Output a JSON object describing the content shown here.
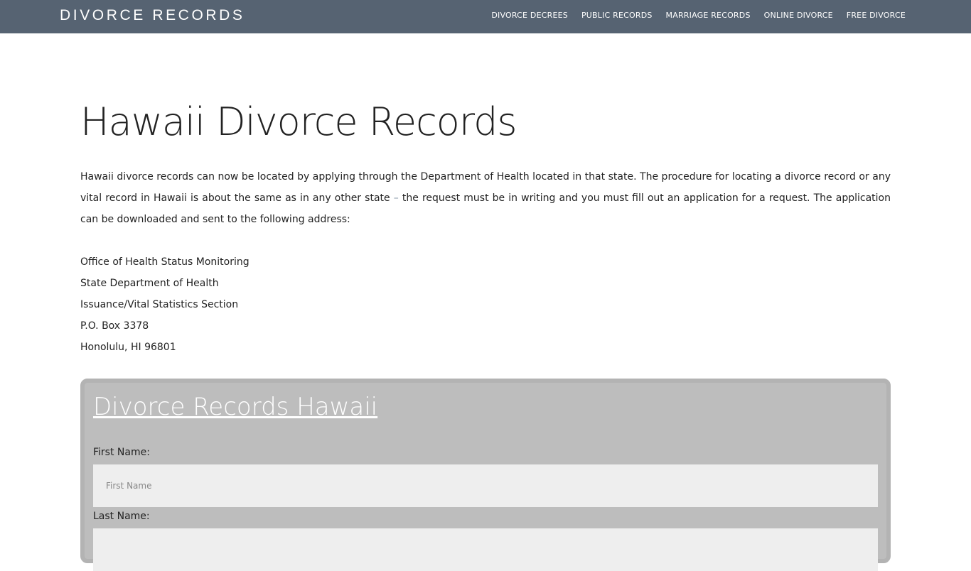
{
  "header": {
    "brand": "DIVORCE RECORDS",
    "nav": [
      {
        "label": "DIVORCE DECREES"
      },
      {
        "label": "PUBLIC RECORDS"
      },
      {
        "label": "MARRIAGE RECORDS"
      },
      {
        "label": "ONLINE DIVORCE"
      },
      {
        "label": "FREE DIVORCE"
      }
    ]
  },
  "main": {
    "title": "Hawaii Divorce Records",
    "intro_part1": "Hawaii divorce records can now be located by applying through the Department of Health located in that state. The procedure for locating a divorce record or any vital record in Hawaii is about the same as in any other state ",
    "intro_dash": "–",
    "intro_part2": " the request must be in writing and you must fill out an application for a request. The application can be downloaded and sent to the following address:",
    "address": [
      "Office of Health Status Monitoring",
      "State Department of Health",
      "Issuance/Vital Statistics Section",
      "P.O. Box 3378",
      "Honolulu, HI 96801"
    ]
  },
  "form": {
    "title": "Divorce Records Hawaii",
    "first_name_label": "First Name:",
    "first_name_placeholder": "First Name",
    "last_name_label": "Last Name:",
    "last_name_placeholder": ""
  },
  "colors": {
    "header_bg": "#566372",
    "form_bg": "#bdbdbd",
    "input_bg": "#eeeeee"
  }
}
